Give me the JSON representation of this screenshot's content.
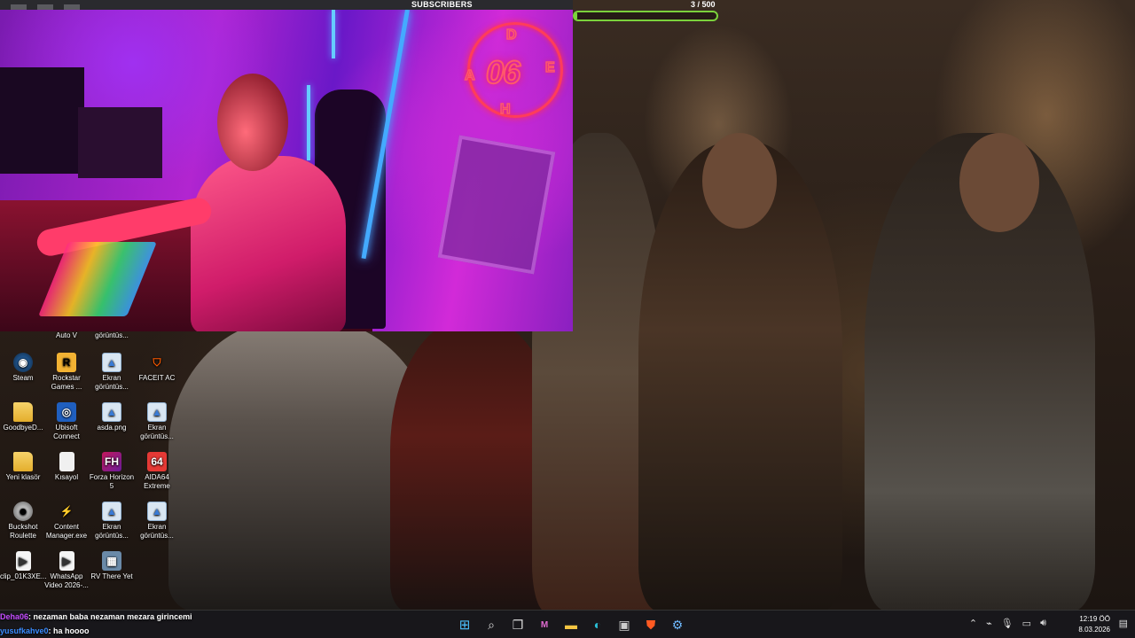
{
  "overlay": {
    "subscribers_label": "SUBSCRIBERS",
    "subscribers_count": "3  / 500",
    "subscribers_fraction": 0.006
  },
  "webcam": {
    "neon_sign": "06",
    "neon_letters": [
      "D",
      "A",
      "E",
      "H"
    ]
  },
  "desktop": {
    "icons": [
      {
        "label": "Auto V",
        "icon": "app-icon"
      },
      {
        "label": "görüntüs...",
        "icon": "image-file-icon"
      },
      {
        "label": "Steam",
        "icon": "steam-icon"
      },
      {
        "label": "Rockstar Games ...",
        "icon": "rockstar-icon"
      },
      {
        "label": "Ekran görüntüs...",
        "icon": "image-file-icon"
      },
      {
        "label": "FACEIT AC",
        "icon": "faceit-icon"
      },
      {
        "label": "GoodbyeD...",
        "icon": "folder-icon"
      },
      {
        "label": "Ubisoft Connect",
        "icon": "ubisoft-icon"
      },
      {
        "label": "asda.png",
        "icon": "image-file-icon"
      },
      {
        "label": "Ekran görüntüs...",
        "icon": "image-file-icon"
      },
      {
        "label": "Yeni klasör",
        "icon": "folder-icon"
      },
      {
        "label": "Kısayol",
        "icon": "file-icon"
      },
      {
        "label": "Forza Horizon 5",
        "icon": "forza-icon"
      },
      {
        "label": "AIDA64 Extreme",
        "icon": "aida64-icon"
      },
      {
        "label": "Buckshot Roulette",
        "icon": "buckshot-icon"
      },
      {
        "label": "Content Manager.exe",
        "icon": "content-manager-icon"
      },
      {
        "label": "Ekran görüntüs...",
        "icon": "image-file-icon"
      },
      {
        "label": "Ekran görüntüs...",
        "icon": "image-file-icon"
      },
      {
        "label": "clip_01K3XE...",
        "icon": "video-file-icon"
      },
      {
        "label": "WhatsApp Video 2026-...",
        "icon": "video-file-icon"
      },
      {
        "label": "RV There Yet",
        "icon": "rv-icon"
      }
    ]
  },
  "chat": {
    "messages": [
      {
        "user": "Deha06",
        "text": ": nezaman baba nezaman mezara girincemi"
      },
      {
        "user": "yusufkahve0",
        "text": ": ha hoooo"
      }
    ]
  },
  "taskbar": {
    "time": "12:19 ÖÖ",
    "date": "8.03.2026",
    "apps": [
      "start-icon",
      "search-icon",
      "task-view-icon",
      "m365-icon",
      "file-explorer-icon",
      "edge-icon",
      "store-icon",
      "brave-icon",
      "settings-icon"
    ]
  },
  "colors": {
    "progress": "#7bd23c",
    "chat_user1": "#c44cff",
    "chat_user2": "#3a8cff"
  }
}
